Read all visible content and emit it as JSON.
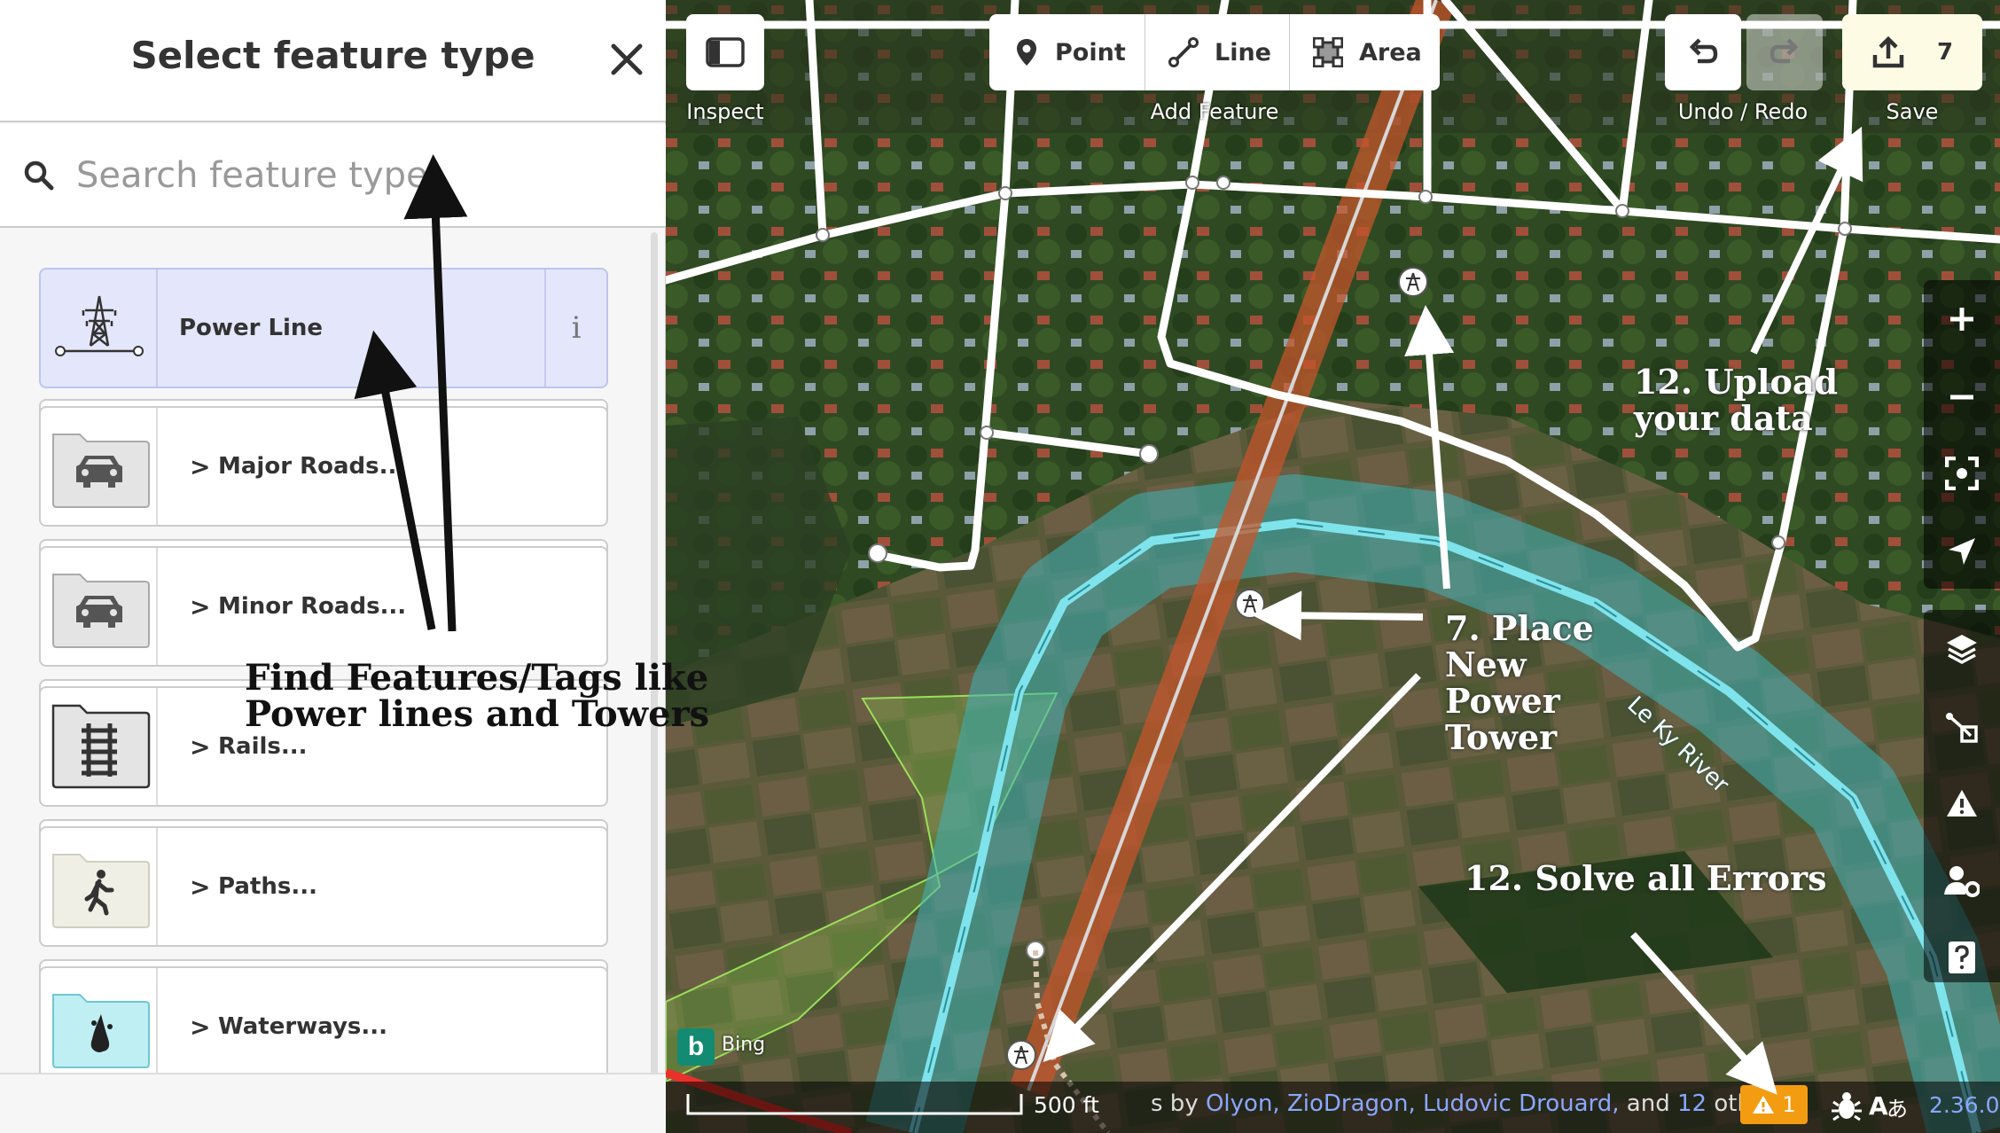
{
  "sidebar": {
    "title": "Select feature type",
    "close_icon": "close-icon",
    "search": {
      "placeholder": "Search feature type",
      "value": ""
    },
    "presets": [
      {
        "label": "Power Line",
        "icon": "power-line-icon",
        "selected": true,
        "info": "i"
      },
      {
        "label": "Major Roads...",
        "icon": "car-folder-icon",
        "chevron": ">"
      },
      {
        "label": "Minor Roads...",
        "icon": "car-folder-icon",
        "chevron": ">"
      },
      {
        "label": "Rails...",
        "icon": "rail-folder-icon",
        "chevron": ">"
      },
      {
        "label": "Paths...",
        "icon": "pedestrian-folder-icon",
        "chevron": ">"
      },
      {
        "label": "Waterways...",
        "icon": "water-folder-icon",
        "chevron": ">"
      }
    ]
  },
  "toolbar": {
    "inspect_label": "Inspect",
    "add_feature_label": "Add Feature",
    "point_label": "Point",
    "line_label": "Line",
    "area_label": "Area",
    "undo_redo_label": "Undo / Redo",
    "save_label": "Save",
    "save_count": "7"
  },
  "map": {
    "imagery": "Bing",
    "river_name": "Le Ky River",
    "scale": "500 ft",
    "attribution": {
      "prefix": "s by",
      "names": [
        "Olyon,",
        "ZioDragon,",
        "Ludovic Drouard,"
      ],
      "and": "and",
      "others_count": "12",
      "others": "others"
    },
    "issues_count": "1",
    "version": "2.36.0"
  },
  "annotations": {
    "find_features": [
      "Find Features/Tags like",
      "Power lines and Towers"
    ],
    "place_tower": [
      "7. Place",
      "New",
      "Power",
      "Tower"
    ],
    "upload": [
      "12. Upload",
      "your data"
    ],
    "solve_errors": "12. Solve all Errors"
  },
  "colors": {
    "selected_preset": "#e4e6fb",
    "water": "#77d3de",
    "power_line": "#b4532a",
    "issues": "#f39c12",
    "link": "#8aa7ff"
  }
}
